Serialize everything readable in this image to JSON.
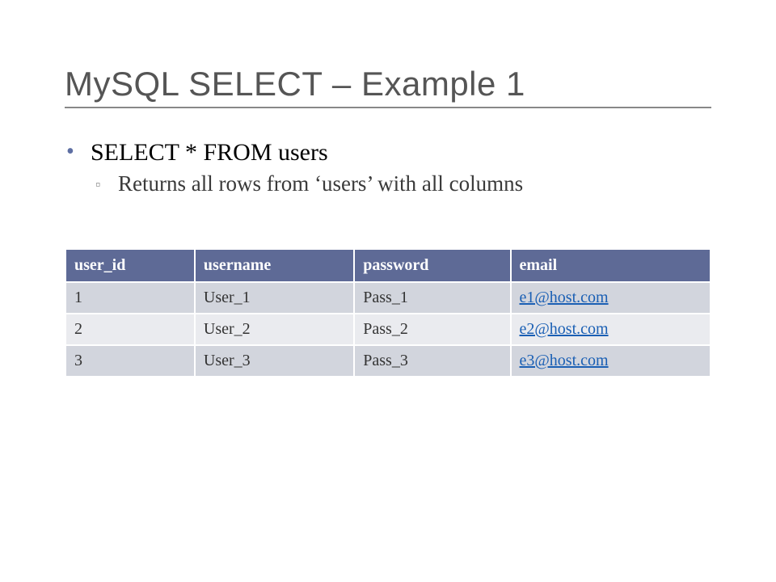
{
  "slide": {
    "title": "MySQL SELECT – Example 1",
    "bullet": "SELECT * FROM users",
    "sub_bullet": "Returns all rows from ‘users’ with all columns"
  },
  "table": {
    "headers": [
      "user_id",
      "username",
      "password",
      "email"
    ],
    "rows": [
      {
        "user_id": "1",
        "username": "User_1",
        "password": "Pass_1",
        "email": "e1@host.com"
      },
      {
        "user_id": "2",
        "username": "User_2",
        "password": "Pass_2",
        "email": "e2@host.com"
      },
      {
        "user_id": "3",
        "username": "User_3",
        "password": "Pass_3",
        "email": "e3@host.com"
      }
    ]
  }
}
